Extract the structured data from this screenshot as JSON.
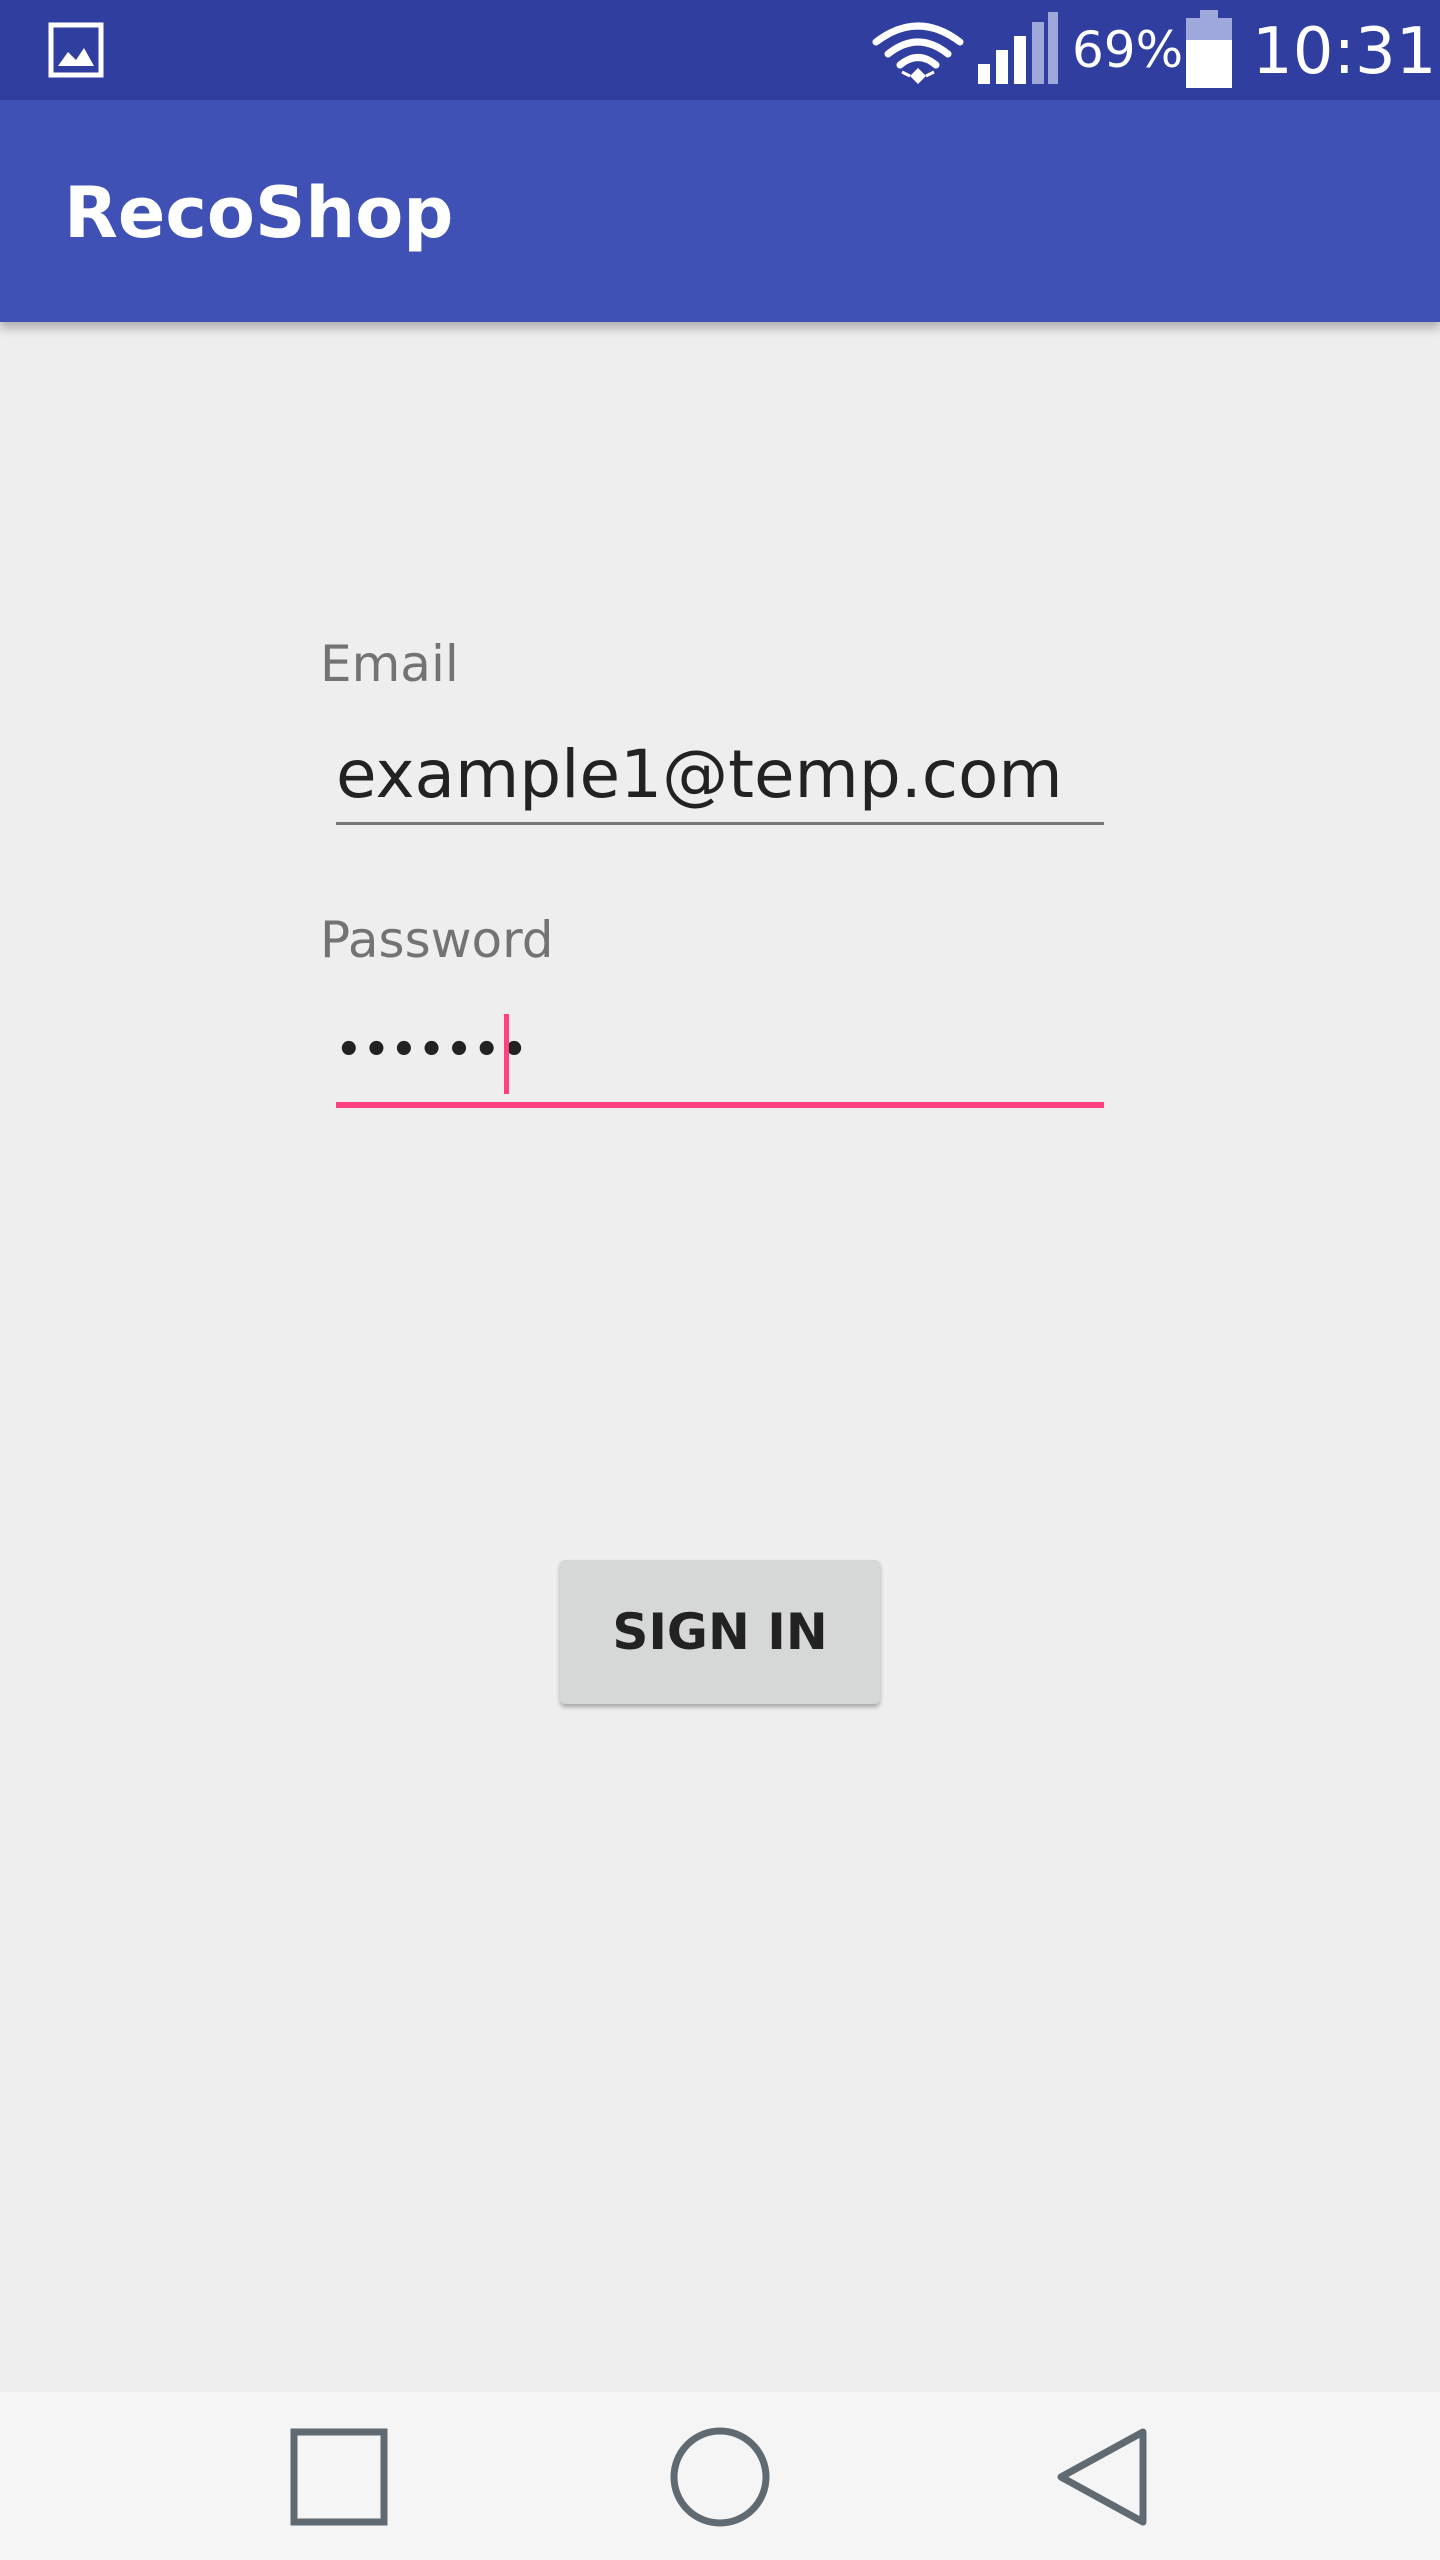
{
  "status_bar": {
    "battery_percent": "69%",
    "time": "10:31",
    "icons": [
      "gallery-icon",
      "wifi-icon",
      "signal-icon",
      "battery-icon"
    ]
  },
  "app_bar": {
    "title": "RecoShop"
  },
  "form": {
    "email_label": "Email",
    "email_value": "example1@temp.com",
    "password_label": "Password",
    "password_masked": "•••••••"
  },
  "sign_in": {
    "label": "SIGN IN"
  },
  "nav_bar": {
    "icons": [
      "recents-icon",
      "home-icon",
      "back-icon"
    ]
  },
  "colors": {
    "status_bar": "#303f9f",
    "app_bar": "#3f51b5",
    "accent": "#ff4081",
    "background": "#eeeeee",
    "button": "#d6d7d7"
  }
}
